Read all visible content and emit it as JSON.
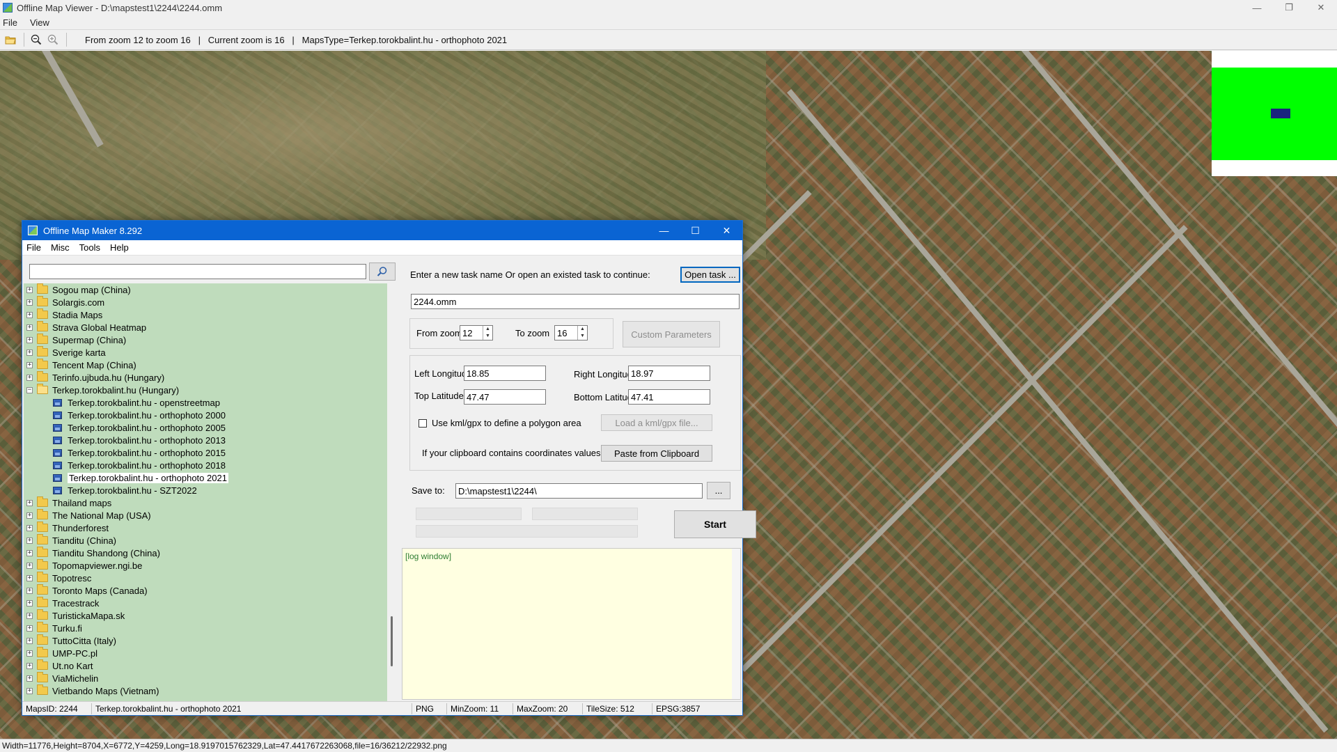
{
  "window": {
    "title": "Offline Map Viewer - D:\\mapstest1\\2244\\2244.omm",
    "controls": {
      "minimize": "—",
      "restore": "❐",
      "close": "✕"
    }
  },
  "menu": [
    "File",
    "View"
  ],
  "toolbar": {
    "icons": [
      "open-folder-icon",
      "zoom-out-icon",
      "zoom-in-icon"
    ],
    "info": "From zoom 12 to zoom 16   |   Current zoom is 16   |   MapsType=Terkep.torokbalint.hu - orthophoto 2021"
  },
  "statusbar": "Width=11776,Height=8704,X=6772,Y=4259,Long=18.9197015762329,Lat=47.4417672263068,file=16/36212/22932.png",
  "overview": {
    "bg": "#00ff00",
    "viewport_color": "#1a237e"
  },
  "dialog": {
    "title": "Offline Map Maker 8.292",
    "menu": [
      "File",
      "Misc",
      "Tools",
      "Help"
    ],
    "search": {
      "value": "",
      "placeholder": ""
    },
    "tree": [
      {
        "label": "Sogou map (China)",
        "type": "folder",
        "expander": "+"
      },
      {
        "label": "Solargis.com",
        "type": "folder",
        "expander": "+"
      },
      {
        "label": "Stadia Maps",
        "type": "folder",
        "expander": "+"
      },
      {
        "label": "Strava Global Heatmap",
        "type": "folder",
        "expander": "+"
      },
      {
        "label": "Supermap (China)",
        "type": "folder",
        "expander": "+"
      },
      {
        "label": "Sverige karta",
        "type": "folder",
        "expander": "+"
      },
      {
        "label": "Tencent Map (China)",
        "type": "folder",
        "expander": "+"
      },
      {
        "label": "Terinfo.ujbuda.hu (Hungary)",
        "type": "folder",
        "expander": "+"
      },
      {
        "label": "Terkep.torokbalint.hu (Hungary)",
        "type": "folder-open",
        "expander": "−"
      },
      {
        "label": "Terkep.torokbalint.hu - openstreetmap",
        "type": "map"
      },
      {
        "label": "Terkep.torokbalint.hu - orthophoto 2000",
        "type": "map"
      },
      {
        "label": "Terkep.torokbalint.hu - orthophoto 2005",
        "type": "map"
      },
      {
        "label": "Terkep.torokbalint.hu - orthophoto 2013",
        "type": "map"
      },
      {
        "label": "Terkep.torokbalint.hu - orthophoto 2015",
        "type": "map"
      },
      {
        "label": "Terkep.torokbalint.hu - orthophoto 2018",
        "type": "map"
      },
      {
        "label": "Terkep.torokbalint.hu - orthophoto 2021",
        "type": "map",
        "selected": true
      },
      {
        "label": "Terkep.torokbalint.hu - SZT2022",
        "type": "map"
      },
      {
        "label": "Thailand maps",
        "type": "folder",
        "expander": "+"
      },
      {
        "label": "The National Map (USA)",
        "type": "folder",
        "expander": "+"
      },
      {
        "label": "Thunderforest",
        "type": "folder",
        "expander": "+"
      },
      {
        "label": "Tianditu (China)",
        "type": "folder",
        "expander": "+"
      },
      {
        "label": "Tianditu Shandong (China)",
        "type": "folder",
        "expander": "+"
      },
      {
        "label": "Topomapviewer.ngi.be",
        "type": "folder",
        "expander": "+"
      },
      {
        "label": "Topotresc",
        "type": "folder",
        "expander": "+"
      },
      {
        "label": "Toronto Maps (Canada)",
        "type": "folder",
        "expander": "+"
      },
      {
        "label": "Tracestrack",
        "type": "folder",
        "expander": "+"
      },
      {
        "label": "TuristickaMapa.sk",
        "type": "folder",
        "expander": "+"
      },
      {
        "label": "Turku.fi",
        "type": "folder",
        "expander": "+"
      },
      {
        "label": "TuttoCitta (Italy)",
        "type": "folder",
        "expander": "+"
      },
      {
        "label": "UMP-PC.pl",
        "type": "folder",
        "expander": "+"
      },
      {
        "label": "Ut.no Kart",
        "type": "folder",
        "expander": "+"
      },
      {
        "label": "ViaMichelin",
        "type": "folder",
        "expander": "+"
      },
      {
        "label": "Vietbando Maps (Vietnam)",
        "type": "folder",
        "expander": "+"
      }
    ],
    "task": {
      "prompt": "Enter a new task name Or open an existed task to continue:",
      "open_button": "Open task ...",
      "name": "2244.omm"
    },
    "zoom": {
      "from_label": "From zoom",
      "from_value": "12",
      "to_label": "To zoom",
      "to_value": "16",
      "custom_button": "Custom Parameters"
    },
    "coords": {
      "left_lon_label": "Left Longitude",
      "left_lon": "18.85",
      "right_lon_label": "Right Longitude",
      "right_lon": "18.97",
      "top_lat_label": "Top Latitude",
      "top_lat": "47.47",
      "bottom_lat_label": "Bottom Latitude",
      "bottom_lat": "47.41",
      "kml_checkbox_label": "Use kml/gpx to define a polygon area",
      "kml_button": "Load a kml/gpx file...",
      "clipboard_label": "If your clipboard contains coordinates values:",
      "clipboard_button": "Paste from Clipboard"
    },
    "save": {
      "label": "Save to:",
      "path": "D:\\mapstest1\\2244\\",
      "browse": "..."
    },
    "start_button": "Start",
    "log": "[log window]",
    "status": {
      "maps_id": "MapsID: 2244",
      "map_name": "Terkep.torokbalint.hu - orthophoto 2021",
      "format": "PNG",
      "min_zoom": "MinZoom: 11",
      "max_zoom": "MaxZoom: 20",
      "tile_size": "TileSize: 512",
      "epsg": "EPSG:3857"
    }
  }
}
